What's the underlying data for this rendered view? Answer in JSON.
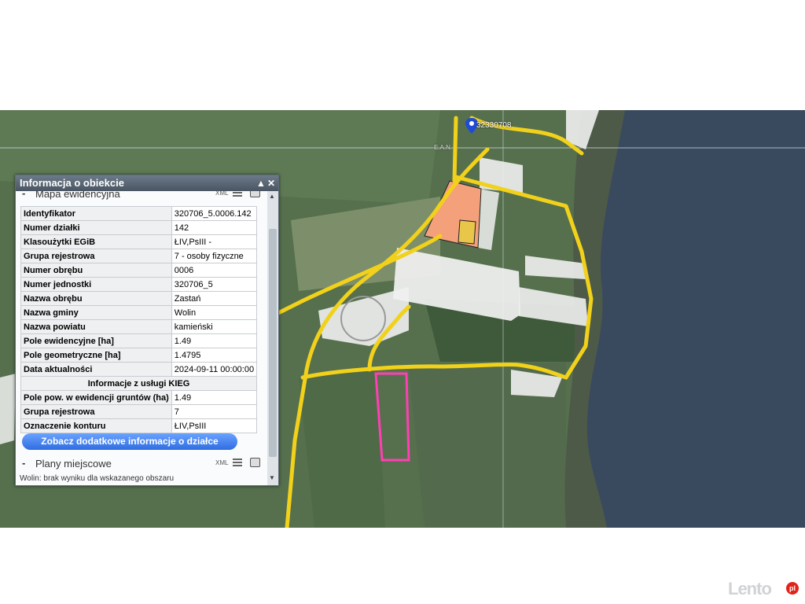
{
  "map": {
    "marker_label": "32330708",
    "top_label": "E.A.N.",
    "colors": {
      "fields": "#56704e",
      "water": "#3a4a5e",
      "roads": "#f2d11b",
      "highlight": "#ff3fb4",
      "parcels": "#ffffff"
    }
  },
  "panel": {
    "title": "Informacja o obiekcie",
    "minimize_glyph": "▲",
    "close_glyph": "✕",
    "section_evidence": "Mapa ewidencyjna",
    "section_plans": "Plany miejscowe",
    "xml_label": "XML",
    "collapse_glyph": "-",
    "rows": [
      {
        "key": "Identyfikator",
        "value": "320706_5.0006.142"
      },
      {
        "key": "Numer działki",
        "value": "142"
      },
      {
        "key": "Klasoużytki EGiB",
        "value": "ŁIV,PsIII -"
      },
      {
        "key": "Grupa rejestrowa",
        "value": "7 - osoby fizyczne"
      },
      {
        "key": "Numer obrębu",
        "value": "0006"
      },
      {
        "key": "Numer jednostki",
        "value": "320706_5"
      },
      {
        "key": "Nazwa obrębu",
        "value": "Zastań"
      },
      {
        "key": "Nazwa gminy",
        "value": "Wolin"
      },
      {
        "key": "Nazwa powiatu",
        "value": "kamieński"
      },
      {
        "key": "Pole ewidencyjne [ha]",
        "value": "1.49"
      },
      {
        "key": "Pole geometryczne [ha]",
        "value": "1.4795"
      },
      {
        "key": "Data aktualności",
        "value": "2024-09-11 00:00:00"
      }
    ],
    "kieg_header": "Informacje z usługi KIEG",
    "kieg_rows": [
      {
        "key": "Pole pow. w ewidencji gruntów (ha)",
        "value": "1.49"
      },
      {
        "key": "Grupa rejestrowa",
        "value": "7"
      },
      {
        "key": "Oznaczenie konturu",
        "value": "ŁIV,PsIII"
      }
    ],
    "more_button": "Zobacz dodatkowe informacje o działce",
    "plans_message": "Wolin: brak wyniku dla wskazanego obszaru",
    "scroll_up_glyph": "▲",
    "scroll_down_glyph": "▼"
  },
  "watermark": {
    "text": "Lento",
    "suffix": "pl"
  }
}
